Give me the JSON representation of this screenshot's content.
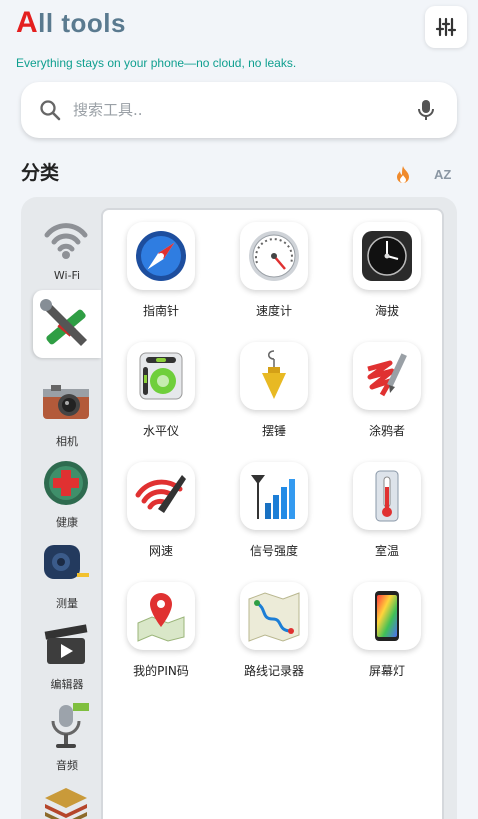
{
  "header": {
    "logo_first": "A",
    "logo_rest": "ll tools",
    "tagline": "Everything stays on your phone—no cloud, no leaks."
  },
  "search": {
    "placeholder": "搜索工具..",
    "value": ""
  },
  "categories": {
    "title": "分类",
    "sort_alpha_label": "AZ"
  },
  "sidebar": {
    "items": [
      {
        "label": "Wi-Fi",
        "icon": "wifi-icon"
      },
      {
        "label": "",
        "icon": "tools-icon",
        "active": true
      },
      {
        "label": "相机",
        "icon": "camera-icon"
      },
      {
        "label": "健康",
        "icon": "health-icon"
      },
      {
        "label": "测量",
        "icon": "tape-measure-icon"
      },
      {
        "label": "编辑器",
        "icon": "video-editor-icon"
      },
      {
        "label": "音频",
        "icon": "microphone-icon"
      },
      {
        "label": "",
        "icon": "layers-icon"
      }
    ]
  },
  "tools": [
    {
      "label": "指南针",
      "icon": "compass-icon"
    },
    {
      "label": "速度计",
      "icon": "speedometer-icon"
    },
    {
      "label": "海拔",
      "icon": "altimeter-icon"
    },
    {
      "label": "水平仪",
      "icon": "level-icon"
    },
    {
      "label": "摆锤",
      "icon": "plumb-bob-icon"
    },
    {
      "label": "涂鸦者",
      "icon": "doodle-icon"
    },
    {
      "label": "网速",
      "icon": "network-speed-icon"
    },
    {
      "label": "信号强度",
      "icon": "signal-icon"
    },
    {
      "label": "室温",
      "icon": "thermometer-icon"
    },
    {
      "label": "我的PIN码",
      "icon": "map-pin-icon"
    },
    {
      "label": "路线记录器",
      "icon": "route-map-icon"
    },
    {
      "label": "屏幕灯",
      "icon": "screen-light-icon"
    }
  ],
  "colors": {
    "accent_red": "#e41f1f",
    "tagline_teal": "#0f9f8f",
    "hot_orange": "#f08a2c"
  }
}
